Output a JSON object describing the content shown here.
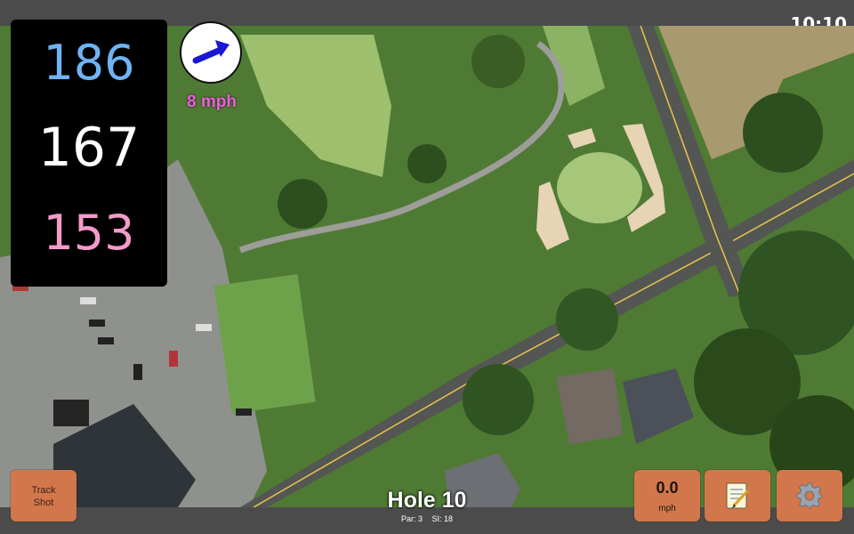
{
  "status": {
    "time": "10:10"
  },
  "distances": {
    "back": "186",
    "middle": "167",
    "front": "153"
  },
  "wind": {
    "speed": "8 mph",
    "direction_icon": "arrow-icon"
  },
  "hole": {
    "title": "Hole 10",
    "par": "Par: 3",
    "stroke_index": "SI: 18"
  },
  "buttons": {
    "track_shot_line1": "Track",
    "track_shot_line2": "Shot",
    "speed_value": "0.0",
    "speed_unit": "mph",
    "notes_icon": "notepad-icon",
    "settings_icon": "gear-icon"
  },
  "colors": {
    "back_distance": "#6fb3f3",
    "middle_distance": "#ffffff",
    "front_distance": "#f29bc9",
    "wind_text": "#ee5fe0",
    "button": "#d2774b"
  }
}
